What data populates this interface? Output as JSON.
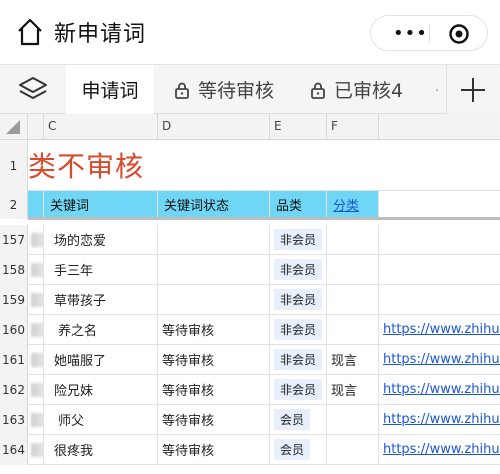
{
  "titlebar": {
    "title": "新申请词",
    "more": "•••"
  },
  "tabs": [
    {
      "label": "申请词",
      "locked": false,
      "active": true
    },
    {
      "label": "等待审核",
      "locked": true,
      "active": false
    },
    {
      "label": "已审核4",
      "locked": true,
      "active": false
    },
    {
      "label": "",
      "locked": true,
      "active": false
    }
  ],
  "columns": [
    "C",
    "D",
    "E",
    "F"
  ],
  "banner_text": "类不审核",
  "headers": {
    "keyword": "关键词",
    "keyword_status": "关键词状态",
    "category": "品类",
    "classify": "分类"
  },
  "rows": [
    {
      "num": "157",
      "keyword": "场的恋爱",
      "status": "",
      "category": "非会员",
      "classify": "",
      "url": ""
    },
    {
      "num": "158",
      "keyword": "手三年",
      "status": "",
      "category": "非会员",
      "classify": "",
      "url": ""
    },
    {
      "num": "159",
      "keyword": "草带孩子",
      "status": "",
      "category": "非会员",
      "classify": "",
      "url": ""
    },
    {
      "num": "160",
      "keyword": "养之名",
      "status": "等待审核",
      "category": "非会员",
      "classify": "",
      "url": "https://www.zhihu.com"
    },
    {
      "num": "161",
      "keyword": "她喵服了",
      "status": "等待审核",
      "category": "非会员",
      "classify": "现言",
      "url": "https://www.zhihu.com"
    },
    {
      "num": "162",
      "keyword": "险兄妹",
      "status": "等待审核",
      "category": "非会员",
      "classify": "现言",
      "url": "https://www.zhihu.com"
    },
    {
      "num": "163",
      "keyword": "师父",
      "status": "等待审核",
      "category": "会员",
      "classify": "",
      "url": "https://www.zhihu.com"
    },
    {
      "num": "164",
      "keyword": "很疼我",
      "status": "等待审核",
      "category": "会员",
      "classify": "",
      "url": "https://www.zhihu.com"
    }
  ],
  "row_labels": {
    "r1": "1",
    "r2": "2"
  },
  "colors": {
    "accent": "#6fd7f5",
    "title_red": "#d84a2c",
    "link": "#1a56d6"
  }
}
